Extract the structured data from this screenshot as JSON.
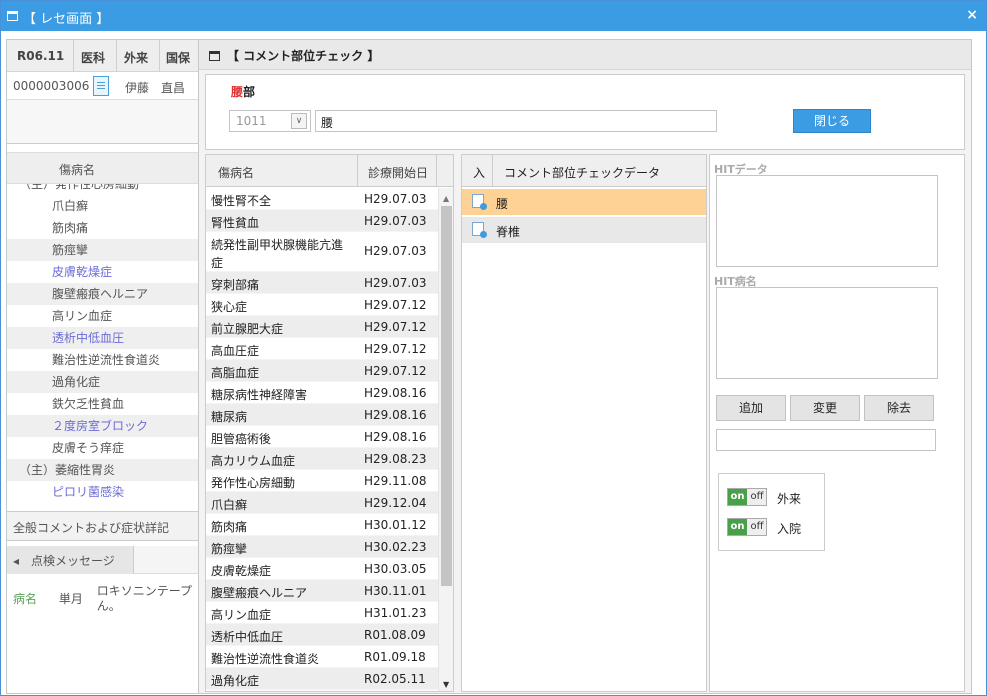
{
  "window": {
    "title": "【 レセ画面 】",
    "close": "×"
  },
  "left": {
    "date": "R06.11",
    "dept": "医科",
    "type": "外来",
    "ins": "国保",
    "patient_id": "0000003006",
    "patient_name": "伊藤　直昌",
    "diag_header": "傷病名",
    "diag": [
      {
        "mark": "（主）",
        "name": "発作性心房細動",
        "alt": false,
        "blue": false,
        "cut": true
      },
      {
        "mark": "",
        "name": "爪白癬",
        "alt": false,
        "blue": false
      },
      {
        "mark": "",
        "name": "筋肉痛",
        "alt": false,
        "blue": false
      },
      {
        "mark": "",
        "name": "筋痙攣",
        "alt": true,
        "blue": false
      },
      {
        "mark": "",
        "name": "皮膚乾燥症",
        "alt": false,
        "blue": true
      },
      {
        "mark": "",
        "name": "腹壁瘢痕ヘルニア",
        "alt": true,
        "blue": false
      },
      {
        "mark": "",
        "name": "高リン血症",
        "alt": false,
        "blue": false
      },
      {
        "mark": "",
        "name": "透析中低血圧",
        "alt": true,
        "blue": true
      },
      {
        "mark": "",
        "name": "難治性逆流性食道炎",
        "alt": false,
        "blue": false
      },
      {
        "mark": "",
        "name": "過角化症",
        "alt": true,
        "blue": false
      },
      {
        "mark": "",
        "name": "鉄欠乏性貧血",
        "alt": false,
        "blue": false
      },
      {
        "mark": "",
        "name": "２度房室ブロック",
        "alt": true,
        "blue": true
      },
      {
        "mark": "",
        "name": "皮膚そう痒症",
        "alt": false,
        "blue": false
      },
      {
        "mark": "（主）",
        "name": "萎縮性胃炎",
        "alt": true,
        "blue": false
      },
      {
        "mark": "",
        "name": "ピロリ菌感染",
        "alt": false,
        "blue": true
      }
    ],
    "comment_label": "全般コメントおよび症状詳記",
    "check_tab": "点検メッセージ",
    "msg_kind": "病名",
    "msg_freq": "単月",
    "msg_text_1": "ロキソニンテープ",
    "msg_text_2": "ん。"
  },
  "dialog": {
    "title": "【 コメント部位チェック 】",
    "label_red": "腰",
    "label_rest": "部",
    "code_value": "1011",
    "text_value": "腰",
    "close": "閉じる",
    "table": {
      "col_name": "傷病名",
      "col_date": "診療開始日",
      "rows": [
        [
          "慢性腎不全",
          "H29.07.03"
        ],
        [
          "腎性貧血",
          "H29.07.03"
        ],
        [
          "続発性副甲状腺機能亢進症",
          "H29.07.03"
        ],
        [
          "穿刺部痛",
          "H29.07.03"
        ],
        [
          "狭心症",
          "H29.07.12"
        ],
        [
          "前立腺肥大症",
          "H29.07.12"
        ],
        [
          "高血圧症",
          "H29.07.12"
        ],
        [
          "高脂血症",
          "H29.07.12"
        ],
        [
          "糖尿病性神経障害",
          "H29.08.16"
        ],
        [
          "糖尿病",
          "H29.08.16"
        ],
        [
          "胆管癌術後",
          "H29.08.16"
        ],
        [
          "高カリウム血症",
          "H29.08.23"
        ],
        [
          "発作性心房細動",
          "H29.11.08"
        ],
        [
          "爪白癬",
          "H29.12.04"
        ],
        [
          "筋肉痛",
          "H30.01.12"
        ],
        [
          "筋痙攣",
          "H30.02.23"
        ],
        [
          "皮膚乾燥症",
          "H30.03.05"
        ],
        [
          "腹壁瘢痕ヘルニア",
          "H30.11.01"
        ],
        [
          "高リン血症",
          "H31.01.23"
        ],
        [
          "透析中低血圧",
          "R01.08.09"
        ],
        [
          "難治性逆流性食道炎",
          "R01.09.18"
        ],
        [
          "過角化症",
          "R02.05.11"
        ]
      ]
    },
    "check": {
      "col_in": "入",
      "col_data": "コメント部位チェックデータ",
      "items": [
        "腰",
        "脊椎"
      ]
    },
    "hit_data": "HITデータ",
    "hit_name": "HIT病名",
    "btn_add": "追加",
    "btn_change": "変更",
    "btn_remove": "除去",
    "toggle_on": "on",
    "toggle_off": "off",
    "opt1": "外来",
    "opt2": "入院"
  }
}
